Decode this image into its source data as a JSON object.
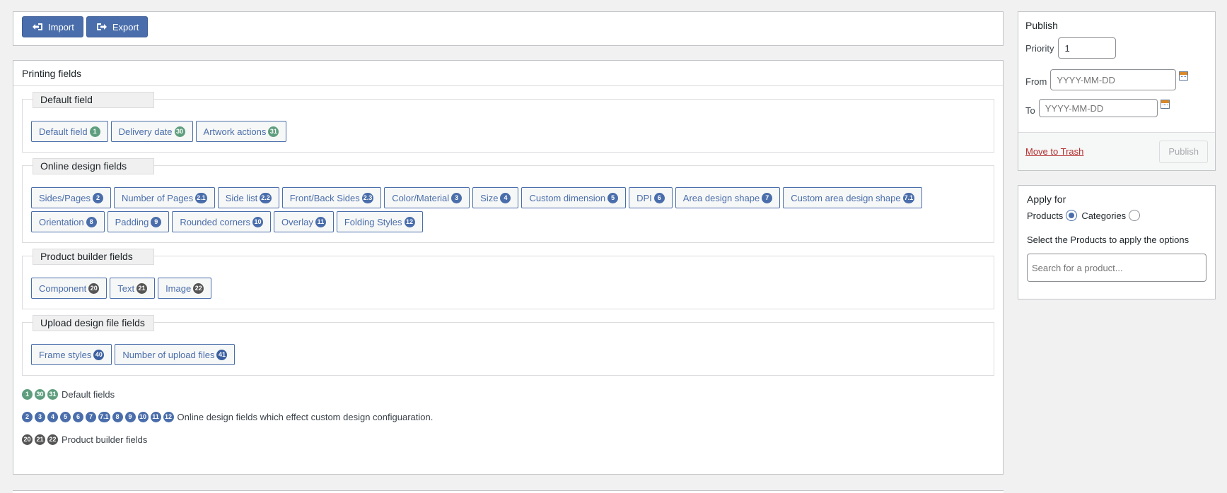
{
  "toolbar": {
    "import_label": "Import",
    "export_label": "Export"
  },
  "printing_fields": {
    "title": "Printing fields",
    "groups": [
      {
        "legend": "Default field",
        "fields": [
          {
            "label": "Default field",
            "badge": "1"
          },
          {
            "label": "Delivery date",
            "badge": "30"
          },
          {
            "label": "Artwork actions",
            "badge": "31"
          }
        ]
      },
      {
        "legend": "Online design fields",
        "fields": [
          {
            "label": "Sides/Pages",
            "badge": "2"
          },
          {
            "label": "Number of Pages",
            "badge": "2.1"
          },
          {
            "label": "Side list",
            "badge": "2.2"
          },
          {
            "label": "Front/Back Sides",
            "badge": "2.3"
          },
          {
            "label": "Color/Material",
            "badge": "3"
          },
          {
            "label": "Size",
            "badge": "4"
          },
          {
            "label": "Custom dimension",
            "badge": "5"
          },
          {
            "label": "DPI",
            "badge": "6"
          },
          {
            "label": "Area design shape",
            "badge": "7"
          },
          {
            "label": "Custom area design shape",
            "badge": "7.1"
          },
          {
            "label": "Orientation",
            "badge": "8"
          },
          {
            "label": "Padding",
            "badge": "9"
          },
          {
            "label": "Rounded corners",
            "badge": "10"
          },
          {
            "label": "Overlay",
            "badge": "11"
          },
          {
            "label": "Folding Styles",
            "badge": "12"
          }
        ]
      },
      {
        "legend": "Product builder fields",
        "fields": [
          {
            "label": "Component",
            "badge": "20"
          },
          {
            "label": "Text",
            "badge": "21"
          },
          {
            "label": "Image",
            "badge": "22"
          }
        ]
      },
      {
        "legend": "Upload design file fields",
        "fields": [
          {
            "label": "Frame styles",
            "badge": "40"
          },
          {
            "label": "Number of upload files",
            "badge": "41"
          }
        ]
      }
    ],
    "legend_lines": [
      {
        "badges": [
          "1",
          "30",
          "31"
        ],
        "text": "Default fields"
      },
      {
        "badges": [
          "2",
          "3",
          "4",
          "5",
          "6",
          "7",
          "7.1",
          "8",
          "9",
          "10",
          "11",
          "12"
        ],
        "text": "Online design fields which effect custom design configuaration."
      },
      {
        "badges": [
          "20",
          "21",
          "22"
        ],
        "text": "Product builder fields"
      }
    ]
  },
  "publish": {
    "title": "Publish",
    "priority_label": "Priority",
    "priority_value": "1",
    "from_label": "From",
    "from_placeholder": "YYYY-MM-DD",
    "to_label": "To",
    "to_placeholder": "YYYY-MM-DD",
    "trash_label": "Move to Trash",
    "publish_label": "Publish"
  },
  "apply_for": {
    "title": "Apply for",
    "products_label": "Products",
    "categories_label": "Categories",
    "selected": "Products",
    "hint": "Select the Products to apply the options",
    "search_placeholder": "Search for a product..."
  },
  "colors": {
    "accent": "#4a6eab",
    "badge_default": "#5e9e7e",
    "badge_online": "#4a6eab",
    "badge_builder": "#555555",
    "trash": "#b32d2e"
  }
}
